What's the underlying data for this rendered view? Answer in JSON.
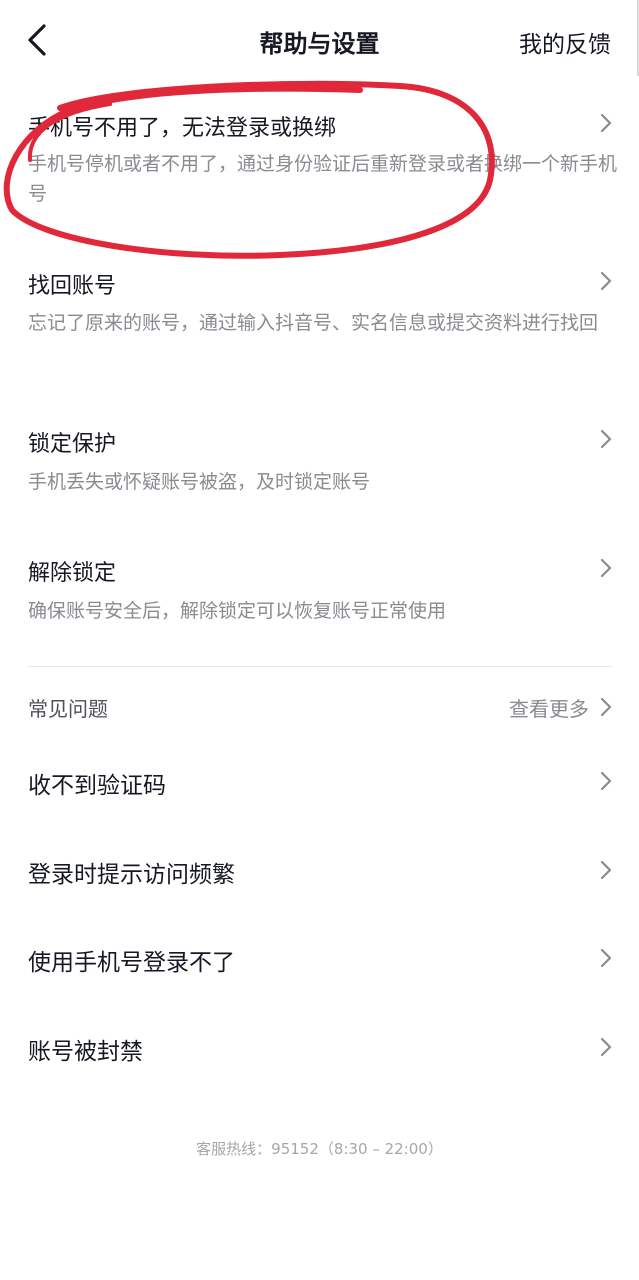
{
  "header": {
    "title": "帮助与设置",
    "feedback_label": "我的反馈"
  },
  "account_items": [
    {
      "title": "手机号不用了，无法登录或换绑",
      "desc": "手机号停机或者不用了，通过身份验证后重新登录或者换绑一个新手机号"
    },
    {
      "title": "找回账号",
      "desc": "忘记了原来的账号，通过输入抖音号、实名信息或提交资料进行找回"
    },
    {
      "title": "锁定保护",
      "desc": "手机丢失或怀疑账号被盗，及时锁定账号"
    },
    {
      "title": "解除锁定",
      "desc": "确保账号安全后，解除锁定可以恢复账号正常使用"
    }
  ],
  "faq": {
    "title": "常见问题",
    "see_more_label": "查看更多",
    "items": [
      "收不到验证码",
      "登录时提示访问频繁",
      "使用手机号登录不了",
      "账号被封禁"
    ]
  },
  "footer": {
    "hotline": "客服热线：95152（8:30 – 22:00）"
  },
  "colors": {
    "annotation_circle": "#e0283a",
    "text_primary": "#161823",
    "text_secondary": "#8a8b91"
  }
}
